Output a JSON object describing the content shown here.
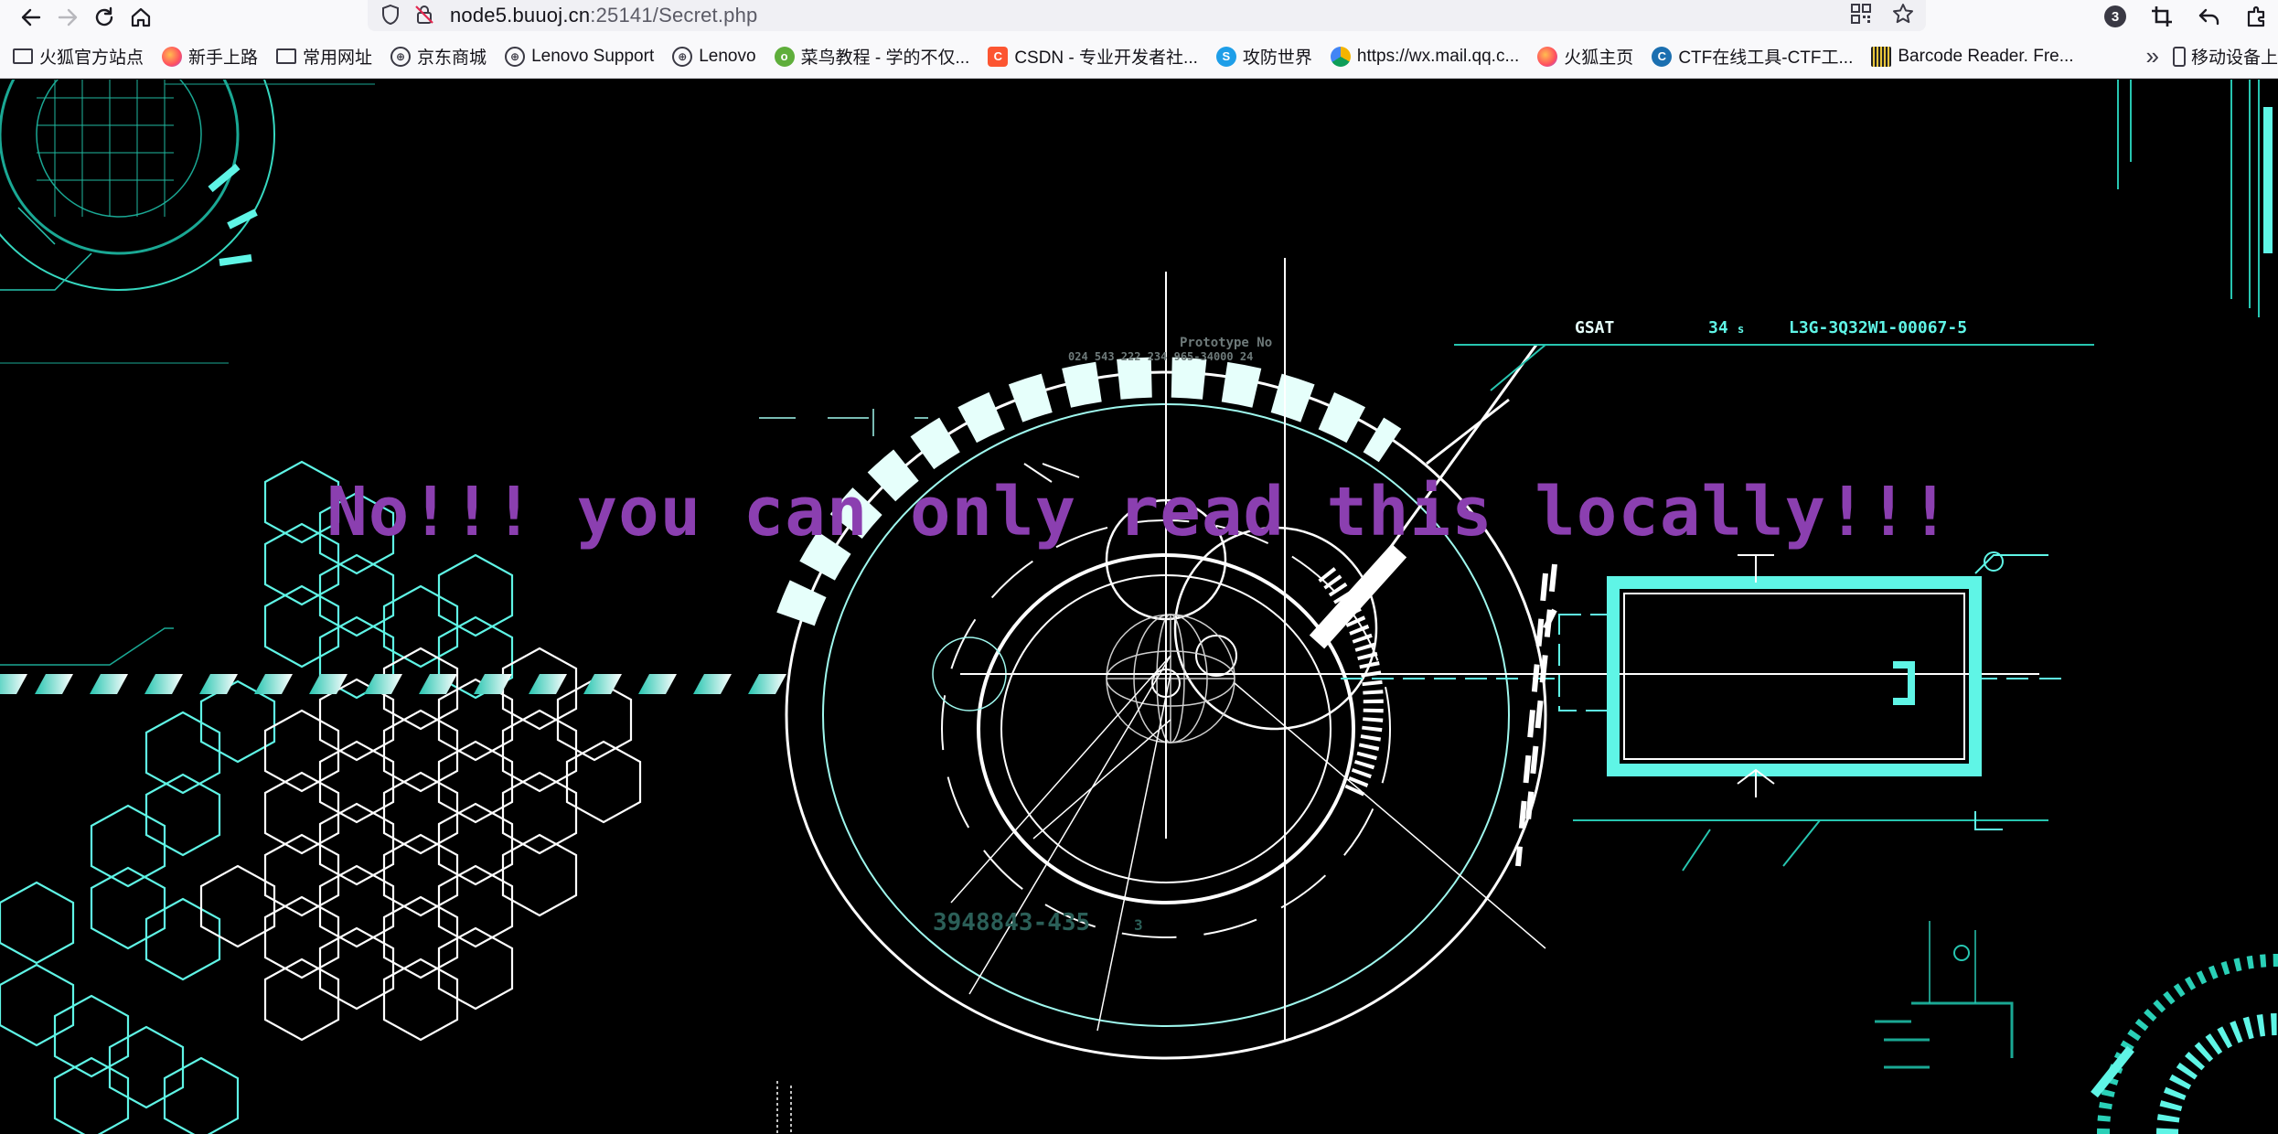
{
  "browser": {
    "url": {
      "host": "node5.buuoj.cn",
      "rest": ":25141/Secret.php",
      "prefix": ""
    },
    "extension_badge": "3",
    "icons": [
      "back-icon",
      "forward-icon",
      "reload-icon",
      "home-icon",
      "shield-icon",
      "insecure-lock-icon",
      "qr-code-icon",
      "bookmark-star-icon",
      "crop-icon",
      "undo-icon",
      "extensions-icon"
    ]
  },
  "bookmarks": [
    {
      "label": "火狐官方站点",
      "icon": "folder-icon"
    },
    {
      "label": "新手上路",
      "icon": "firefox-icon"
    },
    {
      "label": "常用网址",
      "icon": "folder-icon"
    },
    {
      "label": "京东商城",
      "icon": "globe-icon"
    },
    {
      "label": "Lenovo Support",
      "icon": "globe-icon"
    },
    {
      "label": "Lenovo",
      "icon": "globe-icon"
    },
    {
      "label": "菜鸟教程 - 学的不仅...",
      "icon": "runoob-icon"
    },
    {
      "label": "CSDN - 专业开发者社...",
      "icon": "csdn-icon"
    },
    {
      "label": "攻防世界",
      "icon": "adworld-icon"
    },
    {
      "label": "https://wx.mail.qq.c...",
      "icon": "qq-icon"
    },
    {
      "label": "火狐主页",
      "icon": "firefox-icon"
    },
    {
      "label": "CTF在线工具-CTF工...",
      "icon": "ctf-icon"
    },
    {
      "label": "Barcode Reader. Fre...",
      "icon": "barcode-icon"
    }
  ],
  "bookmarks_overflow_label": "»",
  "mobile_bookmarks_label": "移动设备上",
  "page": {
    "message": "No!!! you can only read this locally!!!",
    "message_color": "#8b3fb0",
    "hud_accent": "#5ff5e6",
    "hud_labels": {
      "gsat": "GSAT",
      "gsat_num": "34",
      "gsat_unit": "s",
      "code": "L3G-3Q32W1-00067-5",
      "prototype": "Prototype No",
      "proto_nums": "024 543 222 234 965-34000 24",
      "bottom_code": "3948843-435",
      "bottom_suffix": "3"
    }
  }
}
